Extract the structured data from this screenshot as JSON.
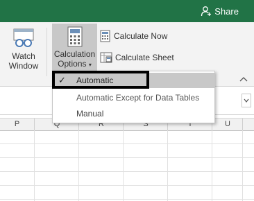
{
  "title_bar": {
    "share_label": "Share"
  },
  "ribbon": {
    "watch_window": {
      "line1": "Watch",
      "line2": "Window"
    },
    "calculation_options": {
      "line1": "Calculation",
      "line2": "Options"
    },
    "calculate_now": "Calculate Now",
    "calculate_sheet": "Calculate Sheet"
  },
  "menu": {
    "items": [
      {
        "label": "Automatic",
        "checked": true
      },
      {
        "label": "Automatic Except for Data Tables",
        "checked": false
      },
      {
        "label": "Manual",
        "checked": false
      }
    ]
  },
  "columns": [
    "P",
    "Q",
    "R",
    "S",
    "T",
    "U"
  ],
  "colors": {
    "excel_green": "#217346",
    "selected_bg": "#c8c8c8"
  }
}
